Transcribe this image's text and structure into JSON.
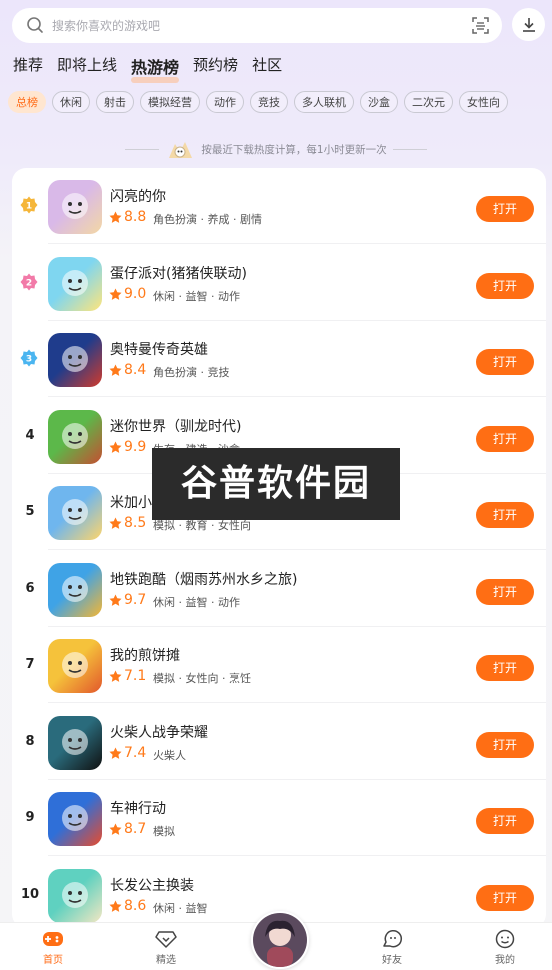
{
  "search": {
    "placeholder": "搜索你喜欢的游戏吧"
  },
  "tabs": [
    {
      "label": "推荐"
    },
    {
      "label": "即将上线"
    },
    {
      "label": "热游榜"
    },
    {
      "label": "预约榜"
    },
    {
      "label": "社区"
    }
  ],
  "categories": [
    "总榜",
    "休闲",
    "射击",
    "模拟经营",
    "动作",
    "竞技",
    "多人联机",
    "沙盒",
    "二次元",
    "女性向"
  ],
  "notice": "按最近下载热度计算，每1小时更新一次",
  "open_label": "打开",
  "games": [
    {
      "rank": "1",
      "name": "闪亮的你",
      "score": "8.8",
      "tags": "角色扮演 · 养成 · 剧情",
      "colors": [
        "#d9b9e8",
        "#f3d7a4"
      ]
    },
    {
      "rank": "2",
      "name": "蛋仔派对(猪猪侠联动)",
      "score": "9.0",
      "tags": "休闲 · 益智 · 动作",
      "colors": [
        "#7fd6f0",
        "#ffe57a"
      ]
    },
    {
      "rank": "3",
      "name": "奥特曼传奇英雄",
      "score": "8.4",
      "tags": "角色扮演 · 竞技",
      "colors": [
        "#1f3c8c",
        "#d23b2b"
      ]
    },
    {
      "rank": "4",
      "name": "迷你世界（驯龙时代)",
      "score": "9.9",
      "tags": "生存 · 建造 · 沙盒",
      "colors": [
        "#5cb84a",
        "#c64e31"
      ]
    },
    {
      "rank": "5",
      "name": "米加小镇:世界",
      "score": "8.5",
      "tags": "模拟 · 教育 · 女性向",
      "colors": [
        "#6fb6ee",
        "#ffd56a"
      ]
    },
    {
      "rank": "6",
      "name": "地铁跑酷（烟雨苏州水乡之旅)",
      "score": "9.7",
      "tags": "休闲 · 益智 · 动作",
      "colors": [
        "#3fa3e6",
        "#f5b633"
      ]
    },
    {
      "rank": "7",
      "name": "我的煎饼摊",
      "score": "7.1",
      "tags": "模拟 · 女性向 · 烹饪",
      "colors": [
        "#f5c23b",
        "#e2572b"
      ]
    },
    {
      "rank": "8",
      "name": "火柴人战争荣耀",
      "score": "7.4",
      "tags": "火柴人",
      "colors": [
        "#2a6b7c",
        "#101010"
      ]
    },
    {
      "rank": "9",
      "name": "车神行动",
      "score": "8.7",
      "tags": "模拟",
      "colors": [
        "#2f6fd8",
        "#e84b2c"
      ]
    },
    {
      "rank": "10",
      "name": "长发公主换装",
      "score": "8.6",
      "tags": "休闲 · 益智",
      "colors": [
        "#5fd1c0",
        "#f4e7c2"
      ]
    }
  ],
  "watermark": "谷普软件园",
  "bottom_nav": [
    {
      "label": "首页"
    },
    {
      "label": "精选"
    },
    {
      "label": "好友"
    },
    {
      "label": "我的"
    }
  ],
  "colors": {
    "accent": "#ff6e14",
    "medal_gold": "#f5b63a",
    "medal_pink": "#f27aa8",
    "medal_blue": "#4bb5f0"
  }
}
